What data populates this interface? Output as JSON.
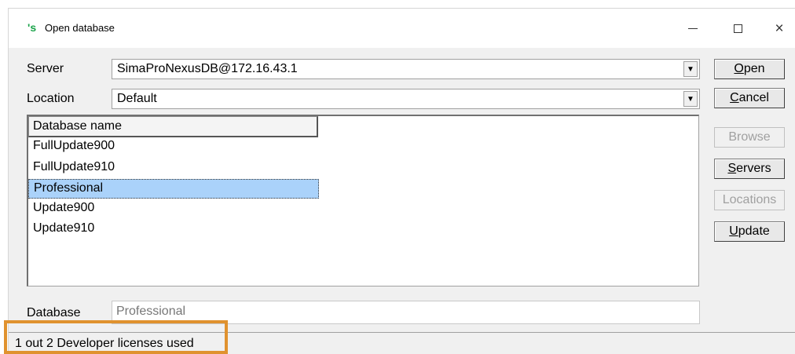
{
  "window": {
    "title": "Open database",
    "app_icon_glyph": "'s",
    "controls": {
      "minimize": "minimize-icon",
      "maximize": "maximize-icon",
      "close": "close-icon"
    }
  },
  "server": {
    "label": "Server",
    "value": "SimaProNexusDB@172.16.43.1"
  },
  "location": {
    "label": "Location",
    "value": "Default"
  },
  "buttons": {
    "open": {
      "pre": "",
      "u": "O",
      "post": "pen"
    },
    "cancel": {
      "pre": "",
      "u": "C",
      "post": "ancel"
    },
    "browse": "Browse",
    "servers": {
      "pre": "",
      "u": "S",
      "post": "ervers"
    },
    "locations": "Locations",
    "update": {
      "pre": "",
      "u": "U",
      "post": "pdate"
    }
  },
  "database_list": {
    "column_header": "Database name",
    "rows": [
      "FullUpdate900",
      "FullUpdate910",
      "Professional",
      "Update900",
      "Update910"
    ],
    "selected": "Professional"
  },
  "database_field": {
    "label": "Database",
    "value": "Professional"
  },
  "status": {
    "text": "1 out 2 Developer licenses used"
  },
  "colors": {
    "selection": "#aad2fa",
    "highlight_box": "#e0922f",
    "app_icon": "#1aa34a"
  }
}
